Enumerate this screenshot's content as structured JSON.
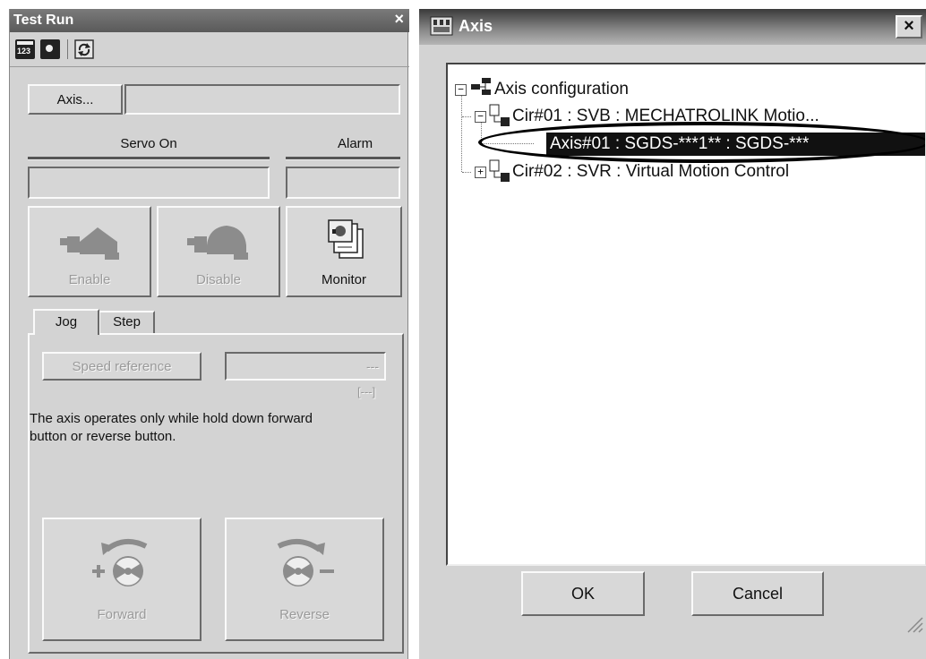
{
  "test_run": {
    "title": "Test Run",
    "close": "×",
    "toolbar": {
      "numeric_icon_text": "123"
    },
    "axis_button": "Axis...",
    "axis_value": "",
    "servo_on_label": "Servo On",
    "alarm_label": "Alarm",
    "servo_on_value": "",
    "alarm_value": "",
    "enable_label": "Enable",
    "disable_label": "Disable",
    "monitor_label": "Monitor",
    "tabs": [
      "Jog",
      "Step"
    ],
    "speed_reference_button": "Speed reference",
    "speed_value": "---",
    "speed_unit": "[---]",
    "info_text": "The axis operates only while hold down forward button or reverse button.",
    "forward_label": "Forward",
    "reverse_label": "Reverse"
  },
  "axis_dialog": {
    "title": "Axis",
    "close": "×",
    "tree": {
      "root": "Axis configuration",
      "cir1": "Cir#01 : SVB : MECHATROLINK Motio...",
      "axis1": "Axis#01 : SGDS-***1** : SGDS-***",
      "cir2": "Cir#02 : SVR : Virtual Motion Control"
    },
    "ok_button": "OK",
    "cancel_button": "Cancel"
  }
}
